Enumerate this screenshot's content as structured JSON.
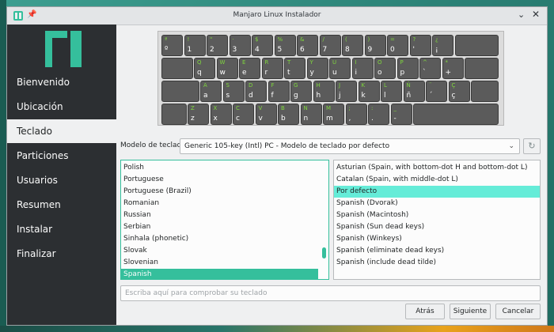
{
  "window": {
    "title": "Manjaro Linux Instalador"
  },
  "sidebar": {
    "items": [
      {
        "label": "Bienvenido"
      },
      {
        "label": "Ubicación"
      },
      {
        "label": "Teclado"
      },
      {
        "label": "Particiones"
      },
      {
        "label": "Usuarios"
      },
      {
        "label": "Resumen"
      },
      {
        "label": "Instalar"
      },
      {
        "label": "Finalizar"
      }
    ],
    "active_index": 2
  },
  "keyboard": {
    "row1": [
      {
        "s": "ª",
        "b": "º"
      },
      {
        "s": "!",
        "b": "1"
      },
      {
        "s": "\"",
        "b": "2"
      },
      {
        "s": "·",
        "b": "3"
      },
      {
        "s": "$",
        "b": "4"
      },
      {
        "s": "%",
        "b": "5"
      },
      {
        "s": "&",
        "b": "6"
      },
      {
        "s": "/",
        "b": "7"
      },
      {
        "s": "(",
        "b": "8"
      },
      {
        "s": ")",
        "b": "9"
      },
      {
        "s": "=",
        "b": "0"
      },
      {
        "s": "?",
        "b": "'"
      },
      {
        "s": "¿",
        "b": "¡"
      }
    ],
    "row2": [
      {
        "s": "Q",
        "b": "q"
      },
      {
        "s": "W",
        "b": "w"
      },
      {
        "s": "E",
        "b": "e"
      },
      {
        "s": "R",
        "b": "r"
      },
      {
        "s": "T",
        "b": "t"
      },
      {
        "s": "Y",
        "b": "y"
      },
      {
        "s": "U",
        "b": "u"
      },
      {
        "s": "I",
        "b": "i"
      },
      {
        "s": "O",
        "b": "o"
      },
      {
        "s": "P",
        "b": "p"
      },
      {
        "s": "^",
        "b": "`"
      },
      {
        "s": "*",
        "b": "+"
      }
    ],
    "row3": [
      {
        "s": "A",
        "b": "a"
      },
      {
        "s": "S",
        "b": "s"
      },
      {
        "s": "D",
        "b": "d"
      },
      {
        "s": "F",
        "b": "f"
      },
      {
        "s": "G",
        "b": "g"
      },
      {
        "s": "H",
        "b": "h"
      },
      {
        "s": "J",
        "b": "j"
      },
      {
        "s": "K",
        "b": "k"
      },
      {
        "s": "L",
        "b": "l"
      },
      {
        "s": "Ñ",
        "b": "ñ"
      },
      {
        "s": "¨",
        "b": "´"
      },
      {
        "s": "Ç",
        "b": "ç"
      }
    ],
    "row4": [
      {
        "s": "Z",
        "b": "z"
      },
      {
        "s": "X",
        "b": "x"
      },
      {
        "s": "C",
        "b": "c"
      },
      {
        "s": "V",
        "b": "v"
      },
      {
        "s": "B",
        "b": "b"
      },
      {
        "s": "N",
        "b": "n"
      },
      {
        "s": "M",
        "b": "m"
      },
      {
        "s": ";",
        "b": ","
      },
      {
        "s": ":",
        "b": "."
      },
      {
        "s": "_",
        "b": "-"
      }
    ]
  },
  "model": {
    "label": "Modelo de teclado:",
    "value": "Generic 105-key (Intl) PC  -  Modelo de teclado por defecto"
  },
  "layouts": {
    "items": [
      "Polish",
      "Portuguese",
      "Portuguese (Brazil)",
      "Romanian",
      "Russian",
      "Serbian",
      "Sinhala (phonetic)",
      "Slovak",
      "Slovenian",
      "Spanish"
    ],
    "selected_index": 9
  },
  "variants": {
    "items": [
      "Asturian (Spain, with bottom-dot H and bottom-dot L)",
      "Catalan (Spain, with middle-dot L)",
      "Por defecto",
      "Spanish (Dvorak)",
      "Spanish (Macintosh)",
      "Spanish (Sun dead keys)",
      "Spanish (Winkeys)",
      "Spanish (eliminate dead keys)",
      "Spanish (include dead tilde)"
    ],
    "selected_index": 2
  },
  "test_input": {
    "placeholder": "Escriba aquí para comprobar su teclado"
  },
  "buttons": {
    "back": "Atrás",
    "next": "Siguiente",
    "cancel": "Cancelar"
  },
  "colors": {
    "accent": "#35bf9c",
    "sidebar": "#2c2f32",
    "key": "#5b5b5b",
    "key_shift": "#7fd63d"
  }
}
